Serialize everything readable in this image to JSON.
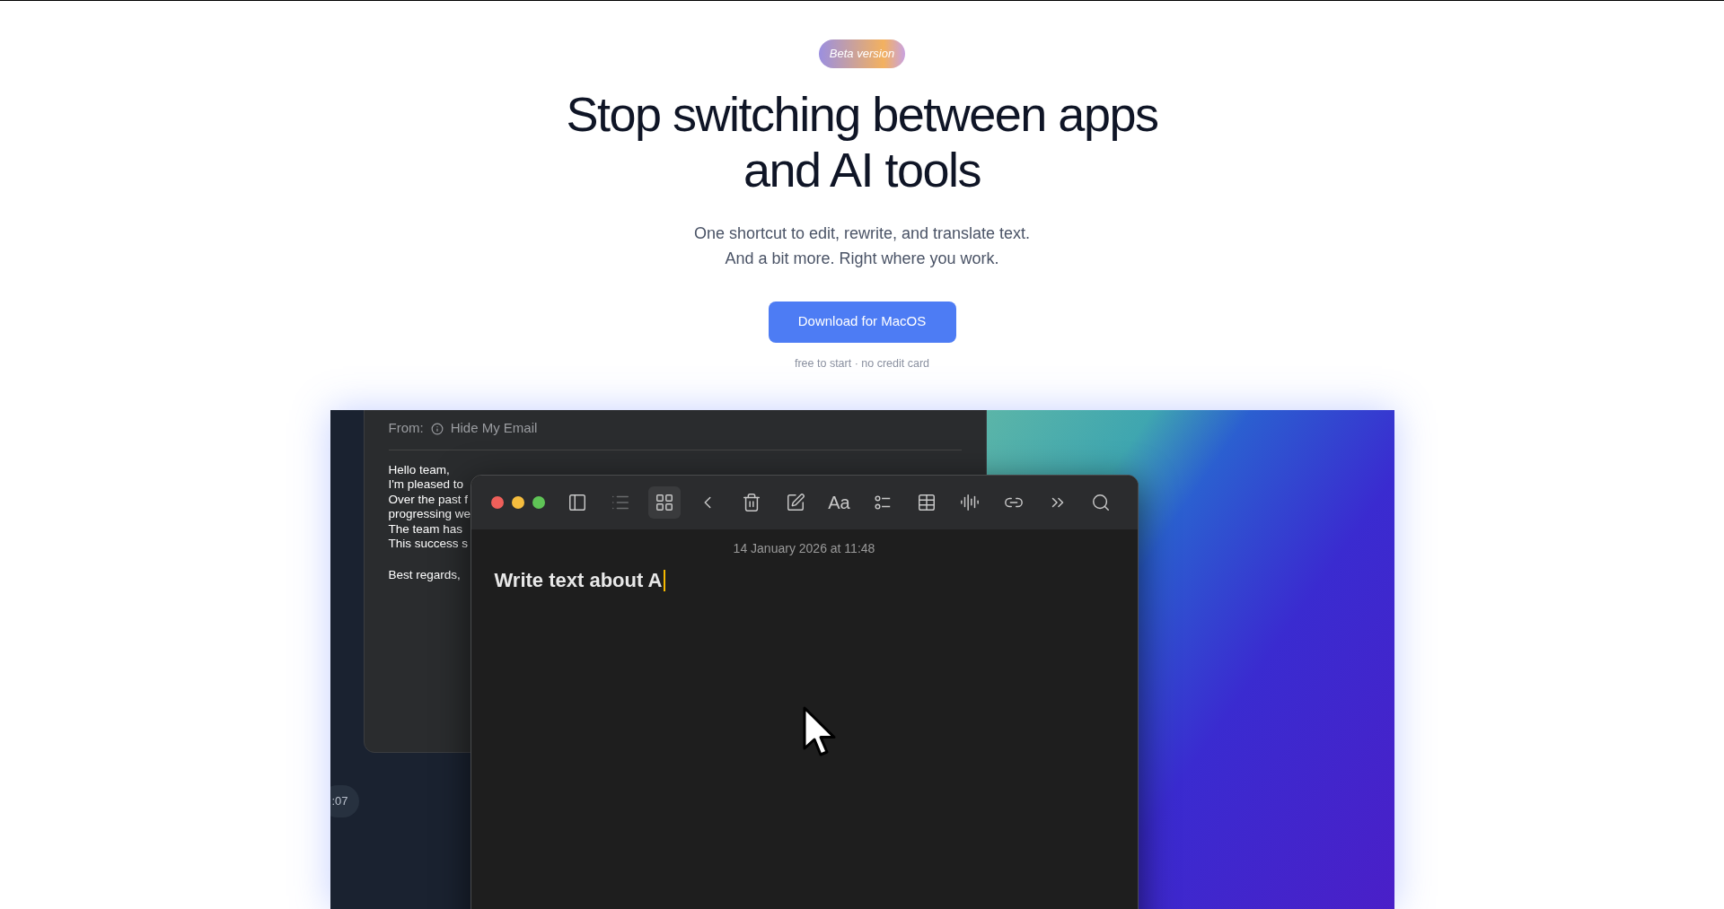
{
  "badge": "Beta version",
  "headline": [
    "Stop switching between apps",
    "and AI tools"
  ],
  "subtitle": [
    "One shortcut to edit, rewrite, and translate text.",
    "And a bit more. Right where you work."
  ],
  "cta": "Download for MacOS",
  "note": "free to start · no credit card",
  "demo": {
    "mail": {
      "from_label": "From:",
      "from_value": "Hide My Email",
      "body_lines": [
        "Hello team,",
        "I'm pleased to",
        "Over the past f",
        "progressing we",
        "The team has",
        "This success s"
      ],
      "signoff": "Best regards,"
    },
    "time_pill": ":07",
    "notes": {
      "toolbar": [
        {
          "kind": "sidebar",
          "selected": false,
          "disabled": false
        },
        {
          "kind": "list",
          "selected": false,
          "disabled": true
        },
        {
          "kind": "grid",
          "selected": true,
          "disabled": false
        },
        {
          "kind": "back",
          "selected": false,
          "disabled": false
        },
        {
          "kind": "trash",
          "selected": false,
          "disabled": false
        },
        {
          "kind": "compose",
          "selected": false,
          "disabled": false
        },
        {
          "kind": "format",
          "label": "Aa",
          "selected": false,
          "disabled": false
        },
        {
          "kind": "checklist",
          "selected": false,
          "disabled": false
        },
        {
          "kind": "table",
          "selected": false,
          "disabled": false
        },
        {
          "kind": "audio",
          "selected": false,
          "disabled": false
        },
        {
          "kind": "link",
          "selected": false,
          "disabled": false
        },
        {
          "kind": "more",
          "selected": false,
          "disabled": false
        },
        {
          "kind": "search",
          "selected": false,
          "disabled": false
        }
      ],
      "date": "14 January 2026 at 11:48",
      "text": "Write text about A"
    }
  }
}
